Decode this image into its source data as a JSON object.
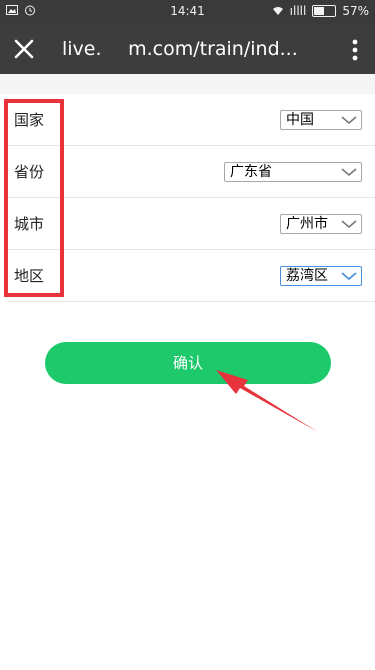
{
  "status_bar": {
    "time": "14:41",
    "battery": "57%",
    "signal": "ıllll"
  },
  "app_bar": {
    "url": "live.       m.com/train/ind..."
  },
  "form": {
    "rows": [
      {
        "label": "国家",
        "value": "中国"
      },
      {
        "label": "省份",
        "value": "广东省"
      },
      {
        "label": "城市",
        "value": "广州市"
      },
      {
        "label": "地区",
        "value": "荔湾区"
      }
    ]
  },
  "confirm_label": "确认",
  "colors": {
    "accent": "#1ec96b",
    "highlight": "#e8323c",
    "toolbar": "#3d3d3d"
  },
  "icons": [
    "close-icon",
    "more-vert-icon",
    "chevron-down-icon",
    "wifi-icon",
    "battery-icon",
    "alarm-icon",
    "image-icon"
  ]
}
